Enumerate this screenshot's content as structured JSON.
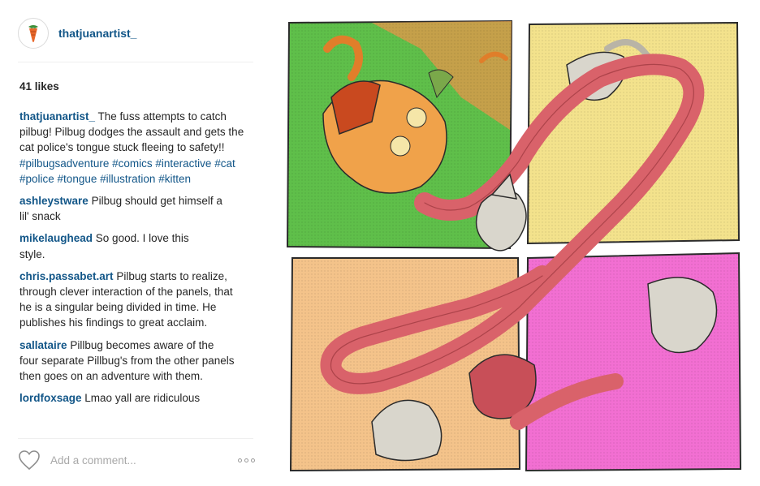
{
  "post": {
    "username": "thatjuanartist_",
    "likes": "41 likes",
    "caption": {
      "user": "thatjuanartist_",
      "text": "The fuss attempts to catch pilbug! Pilbug dodges the assault and gets the cat police's tongue stuck fleeing to safety!!",
      "hashtags": [
        "#pilbugsadventure",
        "#comics",
        "#interactive",
        "#cat",
        "#police",
        "#tongue",
        "#illustration",
        "#kitten"
      ]
    },
    "comments": [
      {
        "user": "ashleystware",
        "text": "Pilbug should get himself a lil' snack"
      },
      {
        "user": "mikelaughead",
        "text": "So good. I love this style."
      },
      {
        "user": "chris.passabet.art",
        "text": "Pilbug starts to realize, through clever interaction of the panels, that he is a singular being divided in time. He publishes his findings to great acclaim."
      },
      {
        "user": "sallataire",
        "text": "Pillbug becomes aware of the four separate Pillbug's from the other panels then goes on an adventure with them."
      },
      {
        "user": "lordfoxsage",
        "text": "Lmao yall are ridiculous"
      }
    ],
    "comment_placeholder": "Add a comment..."
  },
  "colors": {
    "link": "#125688",
    "text": "#262626",
    "placeholder": "#a8a8a8",
    "panel_green": "#5fbf4a",
    "panel_yellow": "#f3e28c",
    "panel_peach": "#f4c38a",
    "panel_pink": "#f26fd2",
    "tongue": "#d9626a"
  },
  "icons": {
    "avatar": "carrot-logo-icon",
    "like": "heart-outline-icon",
    "more": "ellipsis-icon"
  }
}
